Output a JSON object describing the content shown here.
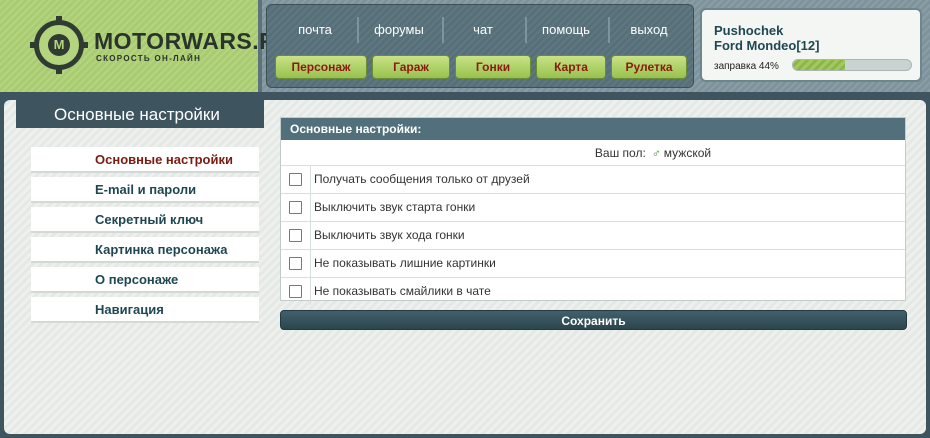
{
  "brand": {
    "name": "MOTORWARS.RU",
    "slogan": "СКОРОСТЬ ОН-ЛАЙН",
    "logo_letter": "M"
  },
  "top_nav": [
    "почта",
    "форумы",
    "чат",
    "помощь",
    "выход"
  ],
  "game_nav": [
    "Персонаж",
    "Гараж",
    "Гонки",
    "Карта",
    "Рулетка"
  ],
  "user": {
    "name": "Pushochek",
    "car": "Ford Mondeo[12]",
    "fuel_label": "заправка 44%",
    "fuel_fraction": 0.44
  },
  "page": {
    "title": "Основные настройки"
  },
  "side_menu": [
    {
      "label": "Основные настройки",
      "active": true
    },
    {
      "label": "E-mail и пароли",
      "active": false
    },
    {
      "label": "Секретный ключ",
      "active": false
    },
    {
      "label": "Картинка персонажа",
      "active": false
    },
    {
      "label": "О персонаже",
      "active": false
    },
    {
      "label": "Навигация",
      "active": false
    }
  ],
  "settings": {
    "header": "Основные настройки:",
    "gender_label": "Ваш пол:",
    "gender_icon": "♂",
    "gender_value": "мужской",
    "options": [
      {
        "label": "Получать сообщения только от друзей",
        "checked": false
      },
      {
        "label": "Выключить звук старта гонки",
        "checked": false
      },
      {
        "label": "Выключить звук хода гонки",
        "checked": false
      },
      {
        "label": "Не показывать лишние картинки",
        "checked": false
      },
      {
        "label": "Не показывать смайлики в чате",
        "checked": false
      }
    ],
    "save_label": "Сохранить"
  },
  "colors": {
    "brand_green": "#b4d47e",
    "dark_teal": "#3e5560",
    "header_teal": "#52707b",
    "link_red": "#7b1b12",
    "button_green": "#98c24e"
  }
}
